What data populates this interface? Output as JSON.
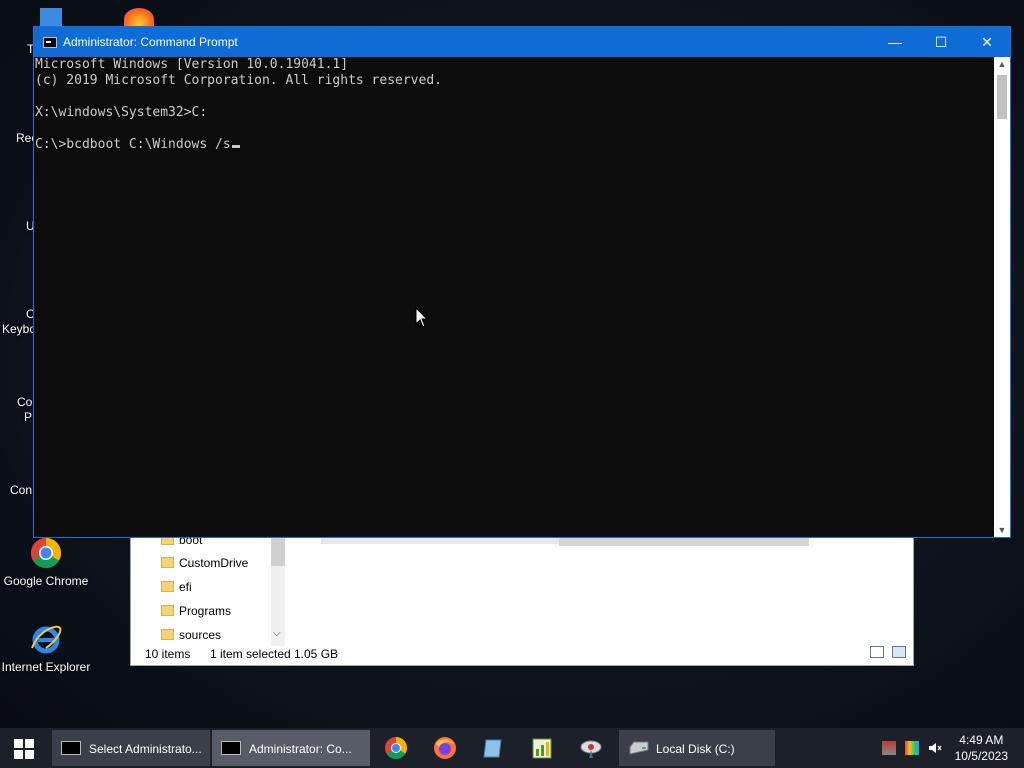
{
  "desktop": {
    "icons": [
      {
        "label": "Google Chrome"
      },
      {
        "label": "Internet Explorer"
      }
    ],
    "partial_labels": [
      "T",
      "Rec",
      "U",
      "C",
      "Keybo",
      "Co",
      "P",
      "Con"
    ]
  },
  "explorer": {
    "tree_items": [
      "boot",
      "CustomDrive",
      "efi",
      "Programs",
      "sources"
    ],
    "status": {
      "count": "10 items",
      "selected": "1 item selected",
      "size": "1.05 GB"
    }
  },
  "cmd": {
    "title": "Administrator: Command Prompt",
    "lines": [
      "Microsoft Windows [Version 10.0.19041.1]",
      "(c) 2019 Microsoft Corporation. All rights reserved.",
      "",
      "X:\\windows\\System32>C:",
      "",
      "C:\\>bcdboot C:\\Windows /s"
    ],
    "window_buttons": {
      "minimize": "—",
      "maximize": "☐",
      "close": "✕"
    }
  },
  "taskbar": {
    "buttons": [
      {
        "label": "Select Administrato..."
      },
      {
        "label": "Administrator: Co..."
      },
      {
        "label": "Local Disk (C:)"
      }
    ],
    "clock": {
      "time": "4:49 AM",
      "date": "10/5/2023"
    }
  },
  "colors": {
    "titlebar": "#0f6cd6",
    "console_bg": "#0c0c0c",
    "console_fg": "#cccccc",
    "taskbar": "#1c2029"
  }
}
